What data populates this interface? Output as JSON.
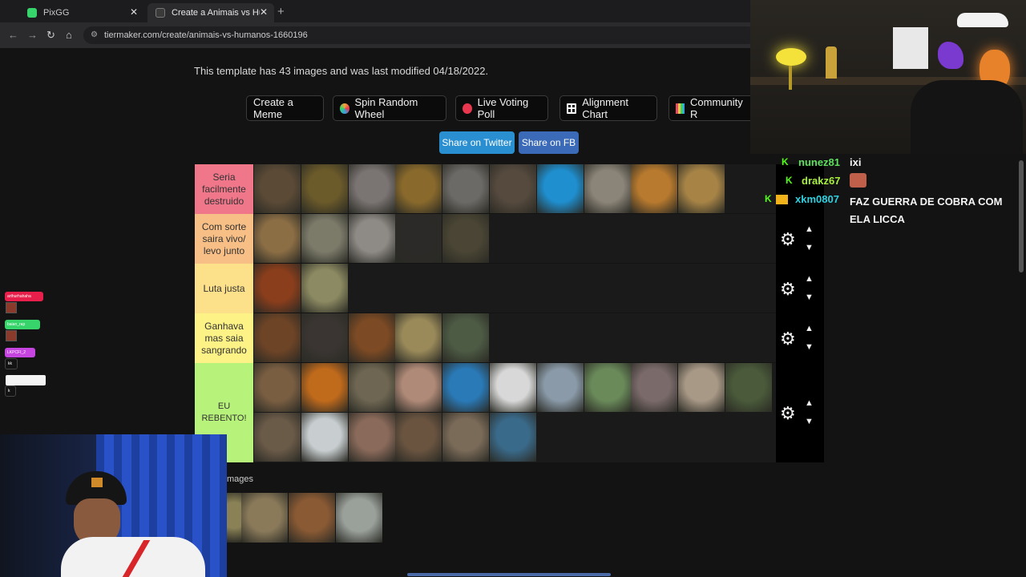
{
  "browser": {
    "tabs": [
      {
        "title": "PixGG",
        "icon_color": "#36d46b",
        "close": "✕"
      },
      {
        "title": "Create a Animais vs Humanos T",
        "icon_color": "#3a3a3a",
        "close": "✕"
      }
    ],
    "new_tab": "+",
    "nav": {
      "back": "←",
      "forward": "→",
      "reload": "↻",
      "home": "⌂"
    },
    "url": "tiermaker.com/create/animais-vs-humanos-1660196",
    "lock": "⚙"
  },
  "page": {
    "info_text": "This template has 43 images and was last modified 04/18/2022.",
    "tool_buttons": [
      {
        "label": "Create a Meme",
        "icon_color": ""
      },
      {
        "label": "Spin Random Wheel",
        "icon_color": "#f2a33a"
      },
      {
        "label": "Live Voting Poll",
        "icon_color": "#e8374f"
      },
      {
        "label": "Alignment Chart",
        "icon_color": "#ffffff"
      },
      {
        "label": "Community R",
        "icon_color": "#e84a5f"
      }
    ],
    "share_buttons": [
      {
        "label": "Share on Twitter"
      },
      {
        "label": "Share on FB"
      }
    ],
    "tiers": [
      {
        "label": "Seria facilmente destruido",
        "color": "#f0768a"
      },
      {
        "label": "Com sorte saira vivo/ levo junto",
        "color": "#f7be85"
      },
      {
        "label": "Luta justa",
        "color": "#fde08a"
      },
      {
        "label": "Ganhava mas saia sangrando",
        "color": "#fdf285"
      },
      {
        "label": "EU REBENTO!",
        "color": "#b7f27a"
      }
    ],
    "tier_images": [
      [
        {
          "name": "bear",
          "color": "#5b4a36"
        },
        {
          "name": "moose",
          "color": "#6b5a2a"
        },
        {
          "name": "hippo",
          "color": "#7a7472"
        },
        {
          "name": "jaguar",
          "color": "#8a6a2c"
        },
        {
          "name": "elephant",
          "color": "#6c6a66"
        },
        {
          "name": "rhino-dark",
          "color": "#564a3e"
        },
        {
          "name": "whale",
          "color": "#1f8fcf"
        },
        {
          "name": "rhino",
          "color": "#8b8478"
        },
        {
          "name": "tiger",
          "color": "#b87a2e"
        },
        {
          "name": "lion",
          "color": "#a78446"
        }
      ],
      [
        {
          "name": "hyena",
          "color": "#8c6e45"
        },
        {
          "name": "crocodile",
          "color": "#7c7b6a"
        },
        {
          "name": "wolf",
          "color": "#8e8a86"
        },
        {
          "name": "chimpanzee",
          "color": "#2c2a28"
        },
        {
          "name": "boar",
          "color": "#4a4534"
        }
      ],
      [
        {
          "name": "orangutan",
          "color": "#8a3e1c"
        },
        {
          "name": "giraffe",
          "color": "#8c8a62"
        }
      ],
      [
        {
          "name": "dog",
          "color": "#6e4426"
        },
        {
          "name": "eagle",
          "color": "#3a3532"
        },
        {
          "name": "wild-dog",
          "color": "#7c4a24"
        },
        {
          "name": "cheetah",
          "color": "#9a8a5a"
        },
        {
          "name": "tapir",
          "color": "#4d5a44"
        }
      ],
      [
        {
          "name": "capybara",
          "color": "#7a5e42"
        },
        {
          "name": "tamarin",
          "color": "#c06a1c"
        },
        {
          "name": "ocelot",
          "color": "#6e6652"
        },
        {
          "name": "pig",
          "color": "#b08a78"
        },
        {
          "name": "macaw",
          "color": "#2a7ab8"
        },
        {
          "name": "penguin",
          "color": "#d8d8d8"
        },
        {
          "name": "ostrich",
          "color": "#8a9aa8"
        },
        {
          "name": "goose",
          "color": "#6a8a5a"
        },
        {
          "name": "dolphin",
          "color": "#7a6a6a"
        },
        {
          "name": "deer",
          "color": "#a89886"
        },
        {
          "name": "harpy-eagle",
          "color": "#4a5a3a"
        },
        {
          "name": "cat",
          "color": "#6a5a48"
        },
        {
          "name": "swan",
          "color": "#c8ced0"
        },
        {
          "name": "fish",
          "color": "#8a6a5a"
        },
        {
          "name": "owl",
          "color": "#6a5440"
        },
        {
          "name": "zebra",
          "color": "#7a6a58"
        },
        {
          "name": "peacock",
          "color": "#3a6a8a"
        }
      ]
    ],
    "unranked_label": "mages",
    "unranked_images": [
      {
        "name": "partial-animal",
        "color": "#8a8256"
      },
      {
        "name": "cobra",
        "color": "#8a7a5a"
      },
      {
        "name": "horse",
        "color": "#8a5a34"
      },
      {
        "name": "panda",
        "color": "#9aa09a"
      }
    ],
    "gear_icon": "⚙",
    "up_icon": "▲",
    "down_icon": "▼"
  },
  "chat": [
    {
      "user": "nunez81",
      "message": "ixi",
      "user_color": "#5ee05e",
      "badge": "K"
    },
    {
      "user": "drakz67",
      "message": "",
      "user_color": "#a9f03c",
      "badge": "K"
    },
    {
      "user": "xkm0807",
      "message": "FAZ GUERRA DE COBRA COM ELA LICCA",
      "user_color": "#2fd0e0",
      "badge": "K"
    }
  ],
  "stream_widgets": [
    {
      "label": "arthurhahaha",
      "color": "#e81f4a"
    },
    {
      "label": "baian_rap",
      "color": "#36d46b"
    },
    {
      "label": "LKPCFI_2",
      "color": "#c644e0"
    },
    {
      "label": "kk",
      "color": ""
    },
    {
      "label": "k",
      "color": ""
    }
  ]
}
